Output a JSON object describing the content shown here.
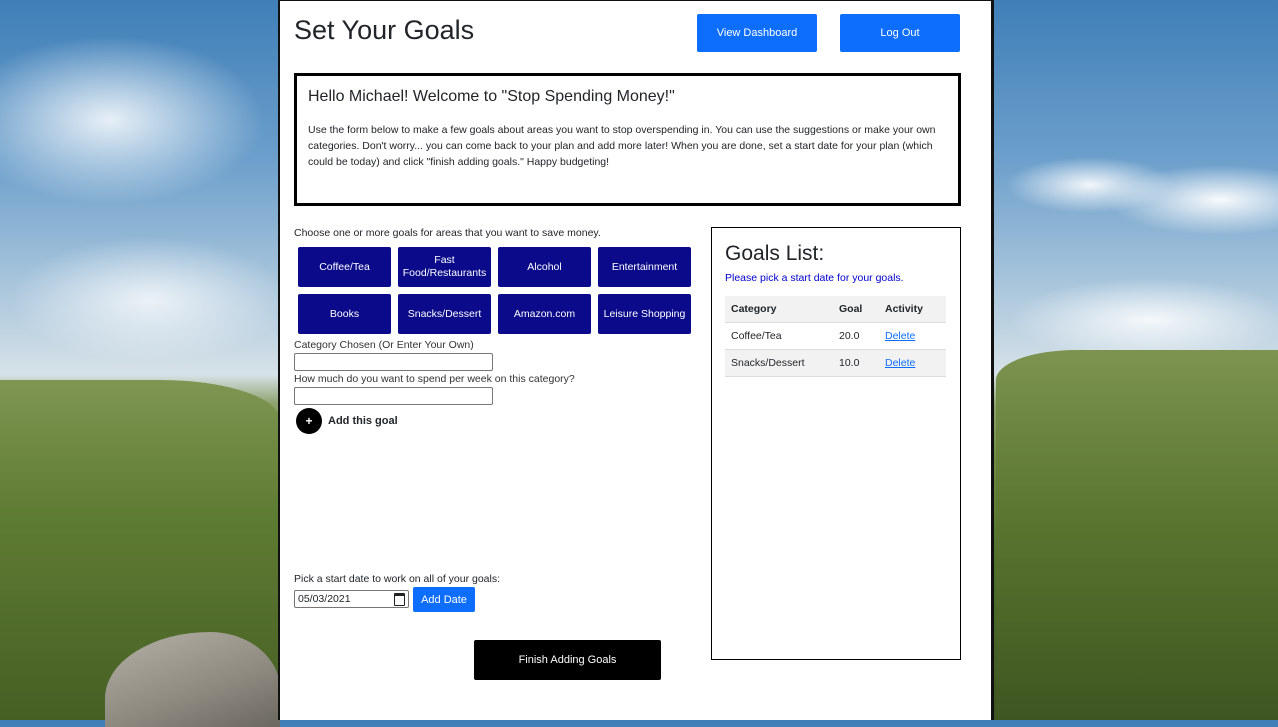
{
  "header": {
    "title": "Set Your Goals",
    "view_dashboard_label": "View Dashboard",
    "logout_label": "Log Out"
  },
  "welcome": {
    "title": "Hello Michael! Welcome to \"Stop Spending Money!\"",
    "text": "Use the form below to make a few goals about areas you want to stop overspending in. You can use the suggestions or make your own categories. Don't worry... you can come back to your plan and add more later! When you are done, set a start date for your plan (which could be today) and click \"finish adding goals.\" Happy budgeting!"
  },
  "form": {
    "choose_label": "Choose one or more goals for areas that you want to save money.",
    "categories": [
      "Coffee/Tea",
      "Fast Food/Restaurants",
      "Alcohol",
      "Entertainment",
      "Books",
      "Snacks/Dessert",
      "Amazon.com",
      "Leisure Shopping"
    ],
    "category_label": "Category Chosen (Or Enter Your Own)",
    "category_value": "",
    "amount_label": "How much do you want to spend per week on this category?",
    "amount_value": "",
    "add_goal_icon": "+",
    "add_goal_label": "Add this goal",
    "date_label": "Pick a start date to work on all of your goals:",
    "date_value": "05/03/2021",
    "add_date_label": "Add Date",
    "finish_label": "Finish Adding Goals"
  },
  "goals_list": {
    "title": "Goals List:",
    "status": "Please pick a start date for your goals.",
    "columns": [
      "Category",
      "Goal",
      "Activity"
    ],
    "rows": [
      {
        "category": "Coffee/Tea",
        "goal": "20.0",
        "activity": "Delete"
      },
      {
        "category": "Snacks/Dessert",
        "goal": "10.0",
        "activity": "Delete"
      }
    ]
  },
  "colors": {
    "primary": "#0d6efd",
    "category_button": "#0a0a8a",
    "finish_button": "#000000",
    "status_text": "#0000cc"
  },
  "icons": {
    "add_goal": "plus-circle-icon",
    "date_picker": "calendar-icon"
  }
}
